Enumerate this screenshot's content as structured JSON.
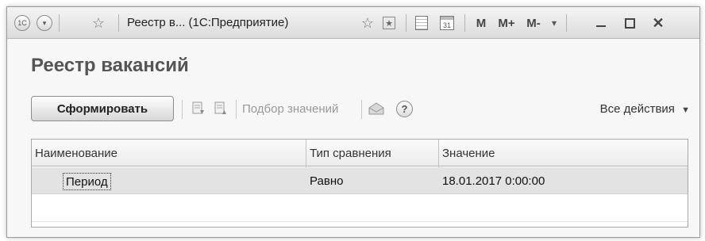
{
  "window": {
    "title": "Реестр в...  (1С:Предприятие)",
    "mem_buttons": [
      "M",
      "M+",
      "M-"
    ]
  },
  "form": {
    "title": "Реестр вакансий",
    "generate_label": "Сформировать",
    "select_values_label": "Подбор значений",
    "all_actions_label": "Все действия",
    "help_label": "?"
  },
  "table": {
    "columns": [
      "Наименование",
      "Тип сравнения",
      "Значение"
    ],
    "rows": [
      {
        "name": "Период",
        "comparison": "Равно",
        "value": "18.01.2017 0:00:00"
      }
    ]
  },
  "colors": {
    "selected_row": "#e3e3e3",
    "title_text": "#555555"
  }
}
